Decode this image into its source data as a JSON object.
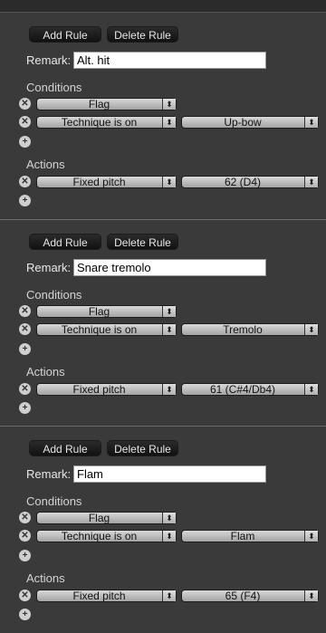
{
  "buttons": {
    "add_label": "Add Rule",
    "delete_label": "Delete Rule"
  },
  "labels": {
    "remark": "Remark:",
    "conditions": "Conditions",
    "actions": "Actions"
  },
  "icons": {
    "remove": "remove-circle-icon",
    "add": "add-circle-icon"
  },
  "rules": [
    {
      "remark": "Alt. hit",
      "conditions": [
        {
          "type": "Flag"
        },
        {
          "type": "Technique is on",
          "value": "Up-bow"
        }
      ],
      "action": {
        "type": "Fixed pitch",
        "value": "62 (D4)"
      }
    },
    {
      "remark": "Snare tremolo",
      "conditions": [
        {
          "type": "Flag"
        },
        {
          "type": "Technique is on",
          "value": "Tremolo"
        }
      ],
      "action": {
        "type": "Fixed pitch",
        "value": "61 (C#4/Db4)"
      }
    },
    {
      "remark": "Flam",
      "conditions": [
        {
          "type": "Flag"
        },
        {
          "type": "Technique is on",
          "value": "Flam"
        }
      ],
      "action": {
        "type": "Fixed pitch",
        "value": "65 (F4)"
      }
    }
  ]
}
